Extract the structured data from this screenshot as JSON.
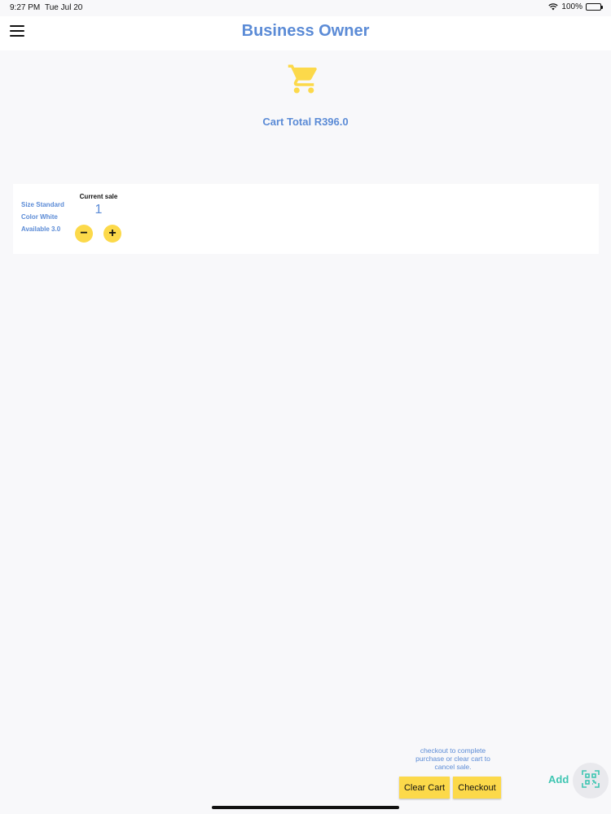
{
  "status_bar": {
    "time": "9:27 PM",
    "date": "Tue Jul 20",
    "battery": "100%"
  },
  "header": {
    "title": "Business Owner",
    "menu_icon": "hamburger-menu-icon"
  },
  "cart": {
    "icon": "shopping-cart-icon",
    "total_label": "Cart Total R396.0",
    "icon_color": "#fcd94a"
  },
  "item": {
    "size": "Size Standard",
    "color": "Color White",
    "available": "Available 3.0",
    "sale_label": "Current sale",
    "quantity": "1",
    "decrement": "−",
    "increment": "+"
  },
  "footer": {
    "hint": "checkout to complete purchase or clear cart to cancel sale.",
    "clear_label": "Clear Cart",
    "checkout_label": "Checkout",
    "add_label": "Add",
    "scan_icon": "qr-scan-icon"
  },
  "colors": {
    "accent": "#5b8bd6",
    "button": "#fcd94a",
    "add": "#3fc6b2"
  }
}
